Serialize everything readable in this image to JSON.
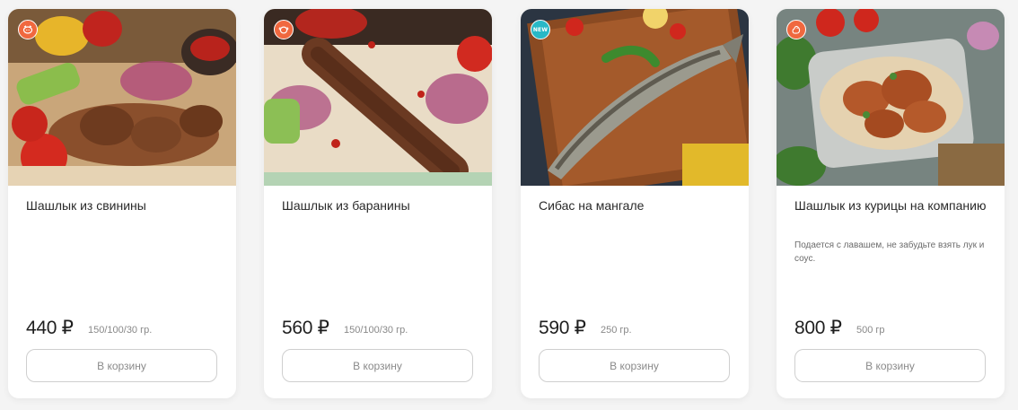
{
  "products": [
    {
      "name": "Шашлык из свинины",
      "description": "",
      "price": "440 ₽",
      "weight": "150/100/30 гр.",
      "button_label": "В корзину",
      "badge": "pig-icon"
    },
    {
      "name": "Шашлык из баранины",
      "description": "",
      "price": "560 ₽",
      "weight": "150/100/30 гр.",
      "button_label": "В корзину",
      "badge": "sheep-icon"
    },
    {
      "name": "Сибас на мангале",
      "description": "",
      "price": "590 ₽",
      "weight": "250 гр.",
      "button_label": "В корзину",
      "badge": "NEW"
    },
    {
      "name": "Шашлык из курицы на компанию",
      "description": "Подается с лавашем, не забудьте взять лук и соус.",
      "price": "800 ₽",
      "weight": "500 гр",
      "button_label": "В корзину",
      "badge": "chicken-icon"
    }
  ],
  "colors": {
    "badge_orange": "#f0683f",
    "badge_new": "#29b8c6",
    "button_border": "#cfcfcf"
  }
}
